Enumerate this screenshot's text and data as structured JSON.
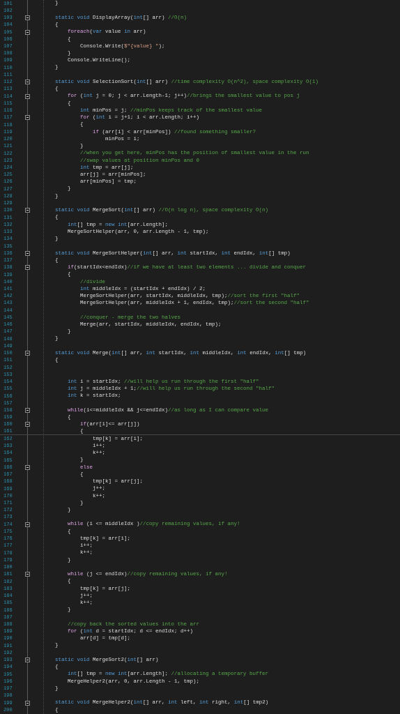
{
  "editor": {
    "lines": [
      {
        "number": "101",
        "foldable": false,
        "current": false,
        "tokens": [
          {
            "kind": "plain",
            "text": "        }"
          }
        ]
      },
      {
        "number": "102",
        "foldable": false,
        "current": false
      },
      {
        "number": "103",
        "foldable": true,
        "current": false,
        "tokens": [
          {
            "kind": "keyword",
            "text": "        static void "
          },
          {
            "kind": "plain",
            "text": "DisplayArray("
          },
          {
            "kind": "keyword",
            "text": "int"
          },
          {
            "kind": "plain",
            "text": "[] arr) "
          },
          {
            "kind": "comment",
            "text": "//O(n)"
          }
        ]
      },
      {
        "number": "104",
        "foldable": false,
        "current": false,
        "tokens": [
          {
            "kind": "plain",
            "text": "        {"
          }
        ]
      },
      {
        "number": "105",
        "foldable": true,
        "current": false,
        "tokens": [
          {
            "kind": "control",
            "text": "            foreach"
          },
          {
            "kind": "plain",
            "text": "("
          },
          {
            "kind": "keyword",
            "text": "var"
          },
          {
            "kind": "plain",
            "text": " value "
          },
          {
            "kind": "keyword",
            "text": "in"
          },
          {
            "kind": "plain",
            "text": " arr)"
          }
        ]
      },
      {
        "number": "106",
        "foldable": false,
        "current": false,
        "tokens": [
          {
            "kind": "plain",
            "text": "            {"
          }
        ]
      },
      {
        "number": "107",
        "foldable": false,
        "current": false,
        "tokens": [
          {
            "kind": "plain",
            "text": "                Console.Write("
          },
          {
            "kind": "string",
            "text": "$\"{value} \""
          },
          {
            "kind": "plain",
            "text": ");"
          }
        ]
      },
      {
        "number": "108",
        "foldable": false,
        "current": false,
        "tokens": [
          {
            "kind": "plain",
            "text": "            }"
          }
        ]
      },
      {
        "number": "109",
        "foldable": false,
        "current": false,
        "tokens": [
          {
            "kind": "plain",
            "text": "            Console.WriteLine();"
          }
        ]
      },
      {
        "number": "110",
        "foldable": false,
        "current": false,
        "tokens": [
          {
            "kind": "plain",
            "text": "        }"
          }
        ]
      },
      {
        "number": "111",
        "foldable": false,
        "current": false
      },
      {
        "number": "112",
        "foldable": true,
        "current": false,
        "tokens": [
          {
            "kind": "keyword",
            "text": "        static void "
          },
          {
            "kind": "plain",
            "text": "SelectionSort("
          },
          {
            "kind": "keyword",
            "text": "int"
          },
          {
            "kind": "plain",
            "text": "[] arr) "
          },
          {
            "kind": "comment",
            "text": "//time complexity O(n^2), space complexity O(1)"
          }
        ]
      },
      {
        "number": "113",
        "foldable": false,
        "current": false,
        "tokens": [
          {
            "kind": "plain",
            "text": "        {"
          }
        ]
      },
      {
        "number": "114",
        "foldable": true,
        "current": false,
        "tokens": [
          {
            "kind": "control",
            "text": "            for"
          },
          {
            "kind": "plain",
            "text": " ("
          },
          {
            "kind": "keyword",
            "text": "int"
          },
          {
            "kind": "plain",
            "text": " j = 0; j < arr.Length-1; j++)"
          },
          {
            "kind": "comment",
            "text": "//brings the smallest value to pos j"
          }
        ]
      },
      {
        "number": "115",
        "foldable": false,
        "current": false,
        "tokens": [
          {
            "kind": "plain",
            "text": "            {"
          }
        ]
      },
      {
        "number": "116",
        "foldable": false,
        "current": false,
        "tokens": [
          {
            "kind": "keyword",
            "text": "                int"
          },
          {
            "kind": "plain",
            "text": " minPos = j; "
          },
          {
            "kind": "comment",
            "text": "//minPos keeps track of the smallest value"
          }
        ]
      },
      {
        "number": "117",
        "foldable": true,
        "current": false,
        "tokens": [
          {
            "kind": "control",
            "text": "                for"
          },
          {
            "kind": "plain",
            "text": " ("
          },
          {
            "kind": "keyword",
            "text": "int"
          },
          {
            "kind": "plain",
            "text": " i = j+1; i < arr.Length; i++)"
          }
        ]
      },
      {
        "number": "118",
        "foldable": false,
        "current": false,
        "tokens": [
          {
            "kind": "plain",
            "text": "                {"
          }
        ]
      },
      {
        "number": "119",
        "foldable": false,
        "current": false,
        "tokens": [
          {
            "kind": "control",
            "text": "                    if"
          },
          {
            "kind": "plain",
            "text": " (arr[i] < arr[minPos]) "
          },
          {
            "kind": "comment",
            "text": "//found something smaller?"
          }
        ]
      },
      {
        "number": "120",
        "foldable": false,
        "current": false,
        "tokens": [
          {
            "kind": "plain",
            "text": "                        minPos = i;"
          }
        ]
      },
      {
        "number": "121",
        "foldable": false,
        "current": false,
        "tokens": [
          {
            "kind": "plain",
            "text": "                }"
          }
        ]
      },
      {
        "number": "122",
        "foldable": false,
        "current": false,
        "tokens": [
          {
            "kind": "comment",
            "text": "                //when you get here, minPos has the position of smallest value in the run"
          }
        ]
      },
      {
        "number": "123",
        "foldable": false,
        "current": false,
        "tokens": [
          {
            "kind": "comment",
            "text": "                //swap values at position minPos and 0"
          }
        ]
      },
      {
        "number": "124",
        "foldable": false,
        "current": false,
        "tokens": [
          {
            "kind": "keyword",
            "text": "                int"
          },
          {
            "kind": "plain",
            "text": " tmp = arr[j];"
          }
        ]
      },
      {
        "number": "125",
        "foldable": false,
        "current": false,
        "tokens": [
          {
            "kind": "plain",
            "text": "                arr[j] = arr[minPos];"
          }
        ]
      },
      {
        "number": "126",
        "foldable": false,
        "current": false,
        "tokens": [
          {
            "kind": "plain",
            "text": "                arr[minPos] = tmp;"
          }
        ]
      },
      {
        "number": "127",
        "foldable": false,
        "current": false,
        "tokens": [
          {
            "kind": "plain",
            "text": "            }"
          }
        ]
      },
      {
        "number": "128",
        "foldable": false,
        "current": false,
        "tokens": [
          {
            "kind": "plain",
            "text": "        }"
          }
        ]
      },
      {
        "number": "129",
        "foldable": false,
        "current": false
      },
      {
        "number": "130",
        "foldable": true,
        "current": false,
        "tokens": [
          {
            "kind": "keyword",
            "text": "        static void "
          },
          {
            "kind": "plain",
            "text": "MergeSort("
          },
          {
            "kind": "keyword",
            "text": "int"
          },
          {
            "kind": "plain",
            "text": "[] arr) "
          },
          {
            "kind": "comment",
            "text": "//O(n log n), space complexity O(n)"
          }
        ]
      },
      {
        "number": "131",
        "foldable": false,
        "current": false,
        "tokens": [
          {
            "kind": "plain",
            "text": "        {"
          }
        ]
      },
      {
        "number": "132",
        "foldable": false,
        "current": false,
        "tokens": [
          {
            "kind": "keyword",
            "text": "            int"
          },
          {
            "kind": "plain",
            "text": "[] tmp = "
          },
          {
            "kind": "keyword",
            "text": "new int"
          },
          {
            "kind": "plain",
            "text": "[arr.Length];"
          }
        ]
      },
      {
        "number": "133",
        "foldable": false,
        "current": false,
        "tokens": [
          {
            "kind": "plain",
            "text": "            MergeSortHelper(arr, 0, arr.Length - 1, tmp);"
          }
        ]
      },
      {
        "number": "134",
        "foldable": false,
        "current": false,
        "tokens": [
          {
            "kind": "plain",
            "text": "        }"
          }
        ]
      },
      {
        "number": "135",
        "foldable": false,
        "current": false
      },
      {
        "number": "136",
        "foldable": true,
        "current": false,
        "tokens": [
          {
            "kind": "keyword",
            "text": "        static void "
          },
          {
            "kind": "plain",
            "text": "MergeSortHelper("
          },
          {
            "kind": "keyword",
            "text": "int"
          },
          {
            "kind": "plain",
            "text": "[] arr, "
          },
          {
            "kind": "keyword",
            "text": "int"
          },
          {
            "kind": "plain",
            "text": " startIdx, "
          },
          {
            "kind": "keyword",
            "text": "int"
          },
          {
            "kind": "plain",
            "text": " endIdx, "
          },
          {
            "kind": "keyword",
            "text": "int"
          },
          {
            "kind": "plain",
            "text": "[] tmp)"
          }
        ]
      },
      {
        "number": "137",
        "foldable": false,
        "current": false,
        "tokens": [
          {
            "kind": "plain",
            "text": "        {"
          }
        ]
      },
      {
        "number": "138",
        "foldable": true,
        "current": false,
        "tokens": [
          {
            "kind": "control",
            "text": "            if"
          },
          {
            "kind": "plain",
            "text": "(startIdx<endIdx)"
          },
          {
            "kind": "comment",
            "text": "//if we have at least two elements ... divide and conquer"
          }
        ]
      },
      {
        "number": "139",
        "foldable": false,
        "current": false,
        "tokens": [
          {
            "kind": "plain",
            "text": "            {"
          }
        ]
      },
      {
        "number": "140",
        "foldable": false,
        "current": false,
        "tokens": [
          {
            "kind": "comment",
            "text": "                //divide"
          }
        ]
      },
      {
        "number": "141",
        "foldable": false,
        "current": false,
        "tokens": [
          {
            "kind": "keyword",
            "text": "                int"
          },
          {
            "kind": "plain",
            "text": " middleIdx = (startIdx + endIdx) / 2;"
          }
        ]
      },
      {
        "number": "142",
        "foldable": false,
        "current": false,
        "tokens": [
          {
            "kind": "plain",
            "text": "                MergeSortHelper(arr, startIdx, middleIdx, tmp);"
          },
          {
            "kind": "comment",
            "text": "//sort the first \"half\""
          }
        ]
      },
      {
        "number": "143",
        "foldable": false,
        "current": false,
        "tokens": [
          {
            "kind": "plain",
            "text": "                MergeSortHelper(arr, middleIdx + 1, endIdx, tmp);"
          },
          {
            "kind": "comment",
            "text": "//sort the second \"half\""
          }
        ]
      },
      {
        "number": "144",
        "foldable": false,
        "current": false
      },
      {
        "number": "145",
        "foldable": false,
        "current": false,
        "tokens": [
          {
            "kind": "comment",
            "text": "                //conquer - merge the two halves"
          }
        ]
      },
      {
        "number": "146",
        "foldable": false,
        "current": false,
        "tokens": [
          {
            "kind": "plain",
            "text": "                Merge(arr, startIdx, middleIdx, endIdx, tmp);"
          }
        ]
      },
      {
        "number": "147",
        "foldable": false,
        "current": false,
        "tokens": [
          {
            "kind": "plain",
            "text": "            }"
          }
        ]
      },
      {
        "number": "148",
        "foldable": false,
        "current": false,
        "tokens": [
          {
            "kind": "plain",
            "text": "        }"
          }
        ]
      },
      {
        "number": "149",
        "foldable": false,
        "current": false
      },
      {
        "number": "150",
        "foldable": true,
        "current": false,
        "tokens": [
          {
            "kind": "keyword",
            "text": "        static void "
          },
          {
            "kind": "plain",
            "text": "Merge("
          },
          {
            "kind": "keyword",
            "text": "int"
          },
          {
            "kind": "plain",
            "text": "[] arr, "
          },
          {
            "kind": "keyword",
            "text": "int"
          },
          {
            "kind": "plain",
            "text": " startIdx, "
          },
          {
            "kind": "keyword",
            "text": "int"
          },
          {
            "kind": "plain",
            "text": " middleIdx, "
          },
          {
            "kind": "keyword",
            "text": "int"
          },
          {
            "kind": "plain",
            "text": " endIdx, "
          },
          {
            "kind": "keyword",
            "text": "int"
          },
          {
            "kind": "plain",
            "text": "[] tmp)"
          }
        ]
      },
      {
        "number": "151",
        "foldable": false,
        "current": false,
        "tokens": [
          {
            "kind": "plain",
            "text": "        {"
          }
        ]
      },
      {
        "number": "152",
        "foldable": false,
        "current": false
      },
      {
        "number": "153",
        "foldable": false,
        "current": false
      },
      {
        "number": "154",
        "foldable": false,
        "current": false,
        "tokens": [
          {
            "kind": "keyword",
            "text": "            int"
          },
          {
            "kind": "plain",
            "text": " i = startIdx; "
          },
          {
            "kind": "comment",
            "text": "//will help us run through the first \"half\""
          }
        ]
      },
      {
        "number": "155",
        "foldable": false,
        "current": false,
        "tokens": [
          {
            "kind": "keyword",
            "text": "            int"
          },
          {
            "kind": "plain",
            "text": " j = middleIdx + 1;"
          },
          {
            "kind": "comment",
            "text": "//will help us run through the second \"half\""
          }
        ]
      },
      {
        "number": "156",
        "foldable": false,
        "current": false,
        "tokens": [
          {
            "kind": "keyword",
            "text": "            int"
          },
          {
            "kind": "plain",
            "text": " k = startIdx;"
          }
        ]
      },
      {
        "number": "157",
        "foldable": false,
        "current": false
      },
      {
        "number": "158",
        "foldable": true,
        "current": false,
        "tokens": [
          {
            "kind": "control",
            "text": "            while"
          },
          {
            "kind": "plain",
            "text": "(i<=middleIdx && j<=endIdx)"
          },
          {
            "kind": "comment",
            "text": "//as long as I can compare value"
          }
        ]
      },
      {
        "number": "159",
        "foldable": false,
        "current": false,
        "tokens": [
          {
            "kind": "plain",
            "text": "            {"
          }
        ]
      },
      {
        "number": "160",
        "foldable": true,
        "current": false,
        "tokens": [
          {
            "kind": "control",
            "text": "                if"
          },
          {
            "kind": "plain",
            "text": "(arr[i]<= arr[j])"
          }
        ]
      },
      {
        "number": "161",
        "foldable": false,
        "current": true,
        "tokens": [
          {
            "kind": "plain",
            "text": "                {"
          }
        ]
      },
      {
        "number": "162",
        "foldable": false,
        "current": false,
        "tokens": [
          {
            "kind": "plain",
            "text": "                    tmp[k] = arr[i];"
          }
        ]
      },
      {
        "number": "163",
        "foldable": false,
        "current": false,
        "tokens": [
          {
            "kind": "plain",
            "text": "                    i++;"
          }
        ]
      },
      {
        "number": "164",
        "foldable": false,
        "current": false,
        "tokens": [
          {
            "kind": "plain",
            "text": "                    k++;"
          }
        ]
      },
      {
        "number": "165",
        "foldable": false,
        "current": false,
        "tokens": [
          {
            "kind": "plain",
            "text": "                }"
          }
        ]
      },
      {
        "number": "166",
        "foldable": true,
        "current": false,
        "tokens": [
          {
            "kind": "control",
            "text": "                else"
          }
        ]
      },
      {
        "number": "167",
        "foldable": false,
        "current": false,
        "tokens": [
          {
            "kind": "plain",
            "text": "                {"
          }
        ]
      },
      {
        "number": "168",
        "foldable": false,
        "current": false,
        "tokens": [
          {
            "kind": "plain",
            "text": "                    tmp[k] = arr[j];"
          }
        ]
      },
      {
        "number": "169",
        "foldable": false,
        "current": false,
        "tokens": [
          {
            "kind": "plain",
            "text": "                    j++;"
          }
        ]
      },
      {
        "number": "170",
        "foldable": false,
        "current": false,
        "tokens": [
          {
            "kind": "plain",
            "text": "                    k++;"
          }
        ]
      },
      {
        "number": "171",
        "foldable": false,
        "current": false,
        "tokens": [
          {
            "kind": "plain",
            "text": "                }"
          }
        ]
      },
      {
        "number": "172",
        "foldable": false,
        "current": false,
        "tokens": [
          {
            "kind": "plain",
            "text": "            }"
          }
        ]
      },
      {
        "number": "173",
        "foldable": false,
        "current": false
      },
      {
        "number": "174",
        "foldable": true,
        "current": false,
        "tokens": [
          {
            "kind": "control",
            "text": "            while"
          },
          {
            "kind": "plain",
            "text": " (i <= middleIdx )"
          },
          {
            "kind": "comment",
            "text": "//copy remaining values, if any!"
          }
        ]
      },
      {
        "number": "175",
        "foldable": false,
        "current": false,
        "tokens": [
          {
            "kind": "plain",
            "text": "            {"
          }
        ]
      },
      {
        "number": "176",
        "foldable": false,
        "current": false,
        "tokens": [
          {
            "kind": "plain",
            "text": "                tmp[k] = arr[i];"
          }
        ]
      },
      {
        "number": "177",
        "foldable": false,
        "current": false,
        "tokens": [
          {
            "kind": "plain",
            "text": "                i++;"
          }
        ]
      },
      {
        "number": "178",
        "foldable": false,
        "current": false,
        "tokens": [
          {
            "kind": "plain",
            "text": "                k++;"
          }
        ]
      },
      {
        "number": "179",
        "foldable": false,
        "current": false,
        "tokens": [
          {
            "kind": "plain",
            "text": "            }"
          }
        ]
      },
      {
        "number": "180",
        "foldable": false,
        "current": false
      },
      {
        "number": "181",
        "foldable": true,
        "current": false,
        "tokens": [
          {
            "kind": "control",
            "text": "            while"
          },
          {
            "kind": "plain",
            "text": " (j <= endIdx)"
          },
          {
            "kind": "comment",
            "text": "//copy remaining values, if any!"
          }
        ]
      },
      {
        "number": "182",
        "foldable": false,
        "current": false,
        "tokens": [
          {
            "kind": "plain",
            "text": "            {"
          }
        ]
      },
      {
        "number": "183",
        "foldable": false,
        "current": false,
        "tokens": [
          {
            "kind": "plain",
            "text": "                tmp[k] = arr[j];"
          }
        ]
      },
      {
        "number": "184",
        "foldable": false,
        "current": false,
        "tokens": [
          {
            "kind": "plain",
            "text": "                j++;"
          }
        ]
      },
      {
        "number": "185",
        "foldable": false,
        "current": false,
        "tokens": [
          {
            "kind": "plain",
            "text": "                k++;"
          }
        ]
      },
      {
        "number": "186",
        "foldable": false,
        "current": false,
        "tokens": [
          {
            "kind": "plain",
            "text": "            }"
          }
        ]
      },
      {
        "number": "187",
        "foldable": false,
        "current": false
      },
      {
        "number": "188",
        "foldable": false,
        "current": false,
        "tokens": [
          {
            "kind": "comment",
            "text": "            //copy back the sorted values into the arr"
          }
        ]
      },
      {
        "number": "189",
        "foldable": false,
        "current": false,
        "tokens": [
          {
            "kind": "control",
            "text": "            for"
          },
          {
            "kind": "plain",
            "text": " ("
          },
          {
            "kind": "keyword",
            "text": "int"
          },
          {
            "kind": "plain",
            "text": " d = startIdx; d <= endIdx; d++)"
          }
        ]
      },
      {
        "number": "190",
        "foldable": false,
        "current": false,
        "tokens": [
          {
            "kind": "plain",
            "text": "                arr[d] = tmp[d];"
          }
        ]
      },
      {
        "number": "191",
        "foldable": false,
        "current": false,
        "tokens": [
          {
            "kind": "plain",
            "text": "        }"
          }
        ]
      },
      {
        "number": "192",
        "foldable": false,
        "current": false
      },
      {
        "number": "193",
        "foldable": true,
        "current": false,
        "tokens": [
          {
            "kind": "keyword",
            "text": "        static void "
          },
          {
            "kind": "plain",
            "text": "MergeSort2("
          },
          {
            "kind": "keyword",
            "text": "int"
          },
          {
            "kind": "plain",
            "text": "[] arr)"
          }
        ]
      },
      {
        "number": "194",
        "foldable": false,
        "current": false,
        "tokens": [
          {
            "kind": "plain",
            "text": "        {"
          }
        ]
      },
      {
        "number": "195",
        "foldable": false,
        "current": false,
        "tokens": [
          {
            "kind": "keyword",
            "text": "            int"
          },
          {
            "kind": "plain",
            "text": "[] tmp = "
          },
          {
            "kind": "keyword",
            "text": "new int"
          },
          {
            "kind": "plain",
            "text": "[arr.Length]; "
          },
          {
            "kind": "comment",
            "text": "//allocating a temporary buffer"
          }
        ]
      },
      {
        "number": "196",
        "foldable": false,
        "current": false,
        "tokens": [
          {
            "kind": "plain",
            "text": "            MergeHelper2(arr, 0, arr.Length - 1, tmp);"
          }
        ]
      },
      {
        "number": "197",
        "foldable": false,
        "current": false,
        "tokens": [
          {
            "kind": "plain",
            "text": "        }"
          }
        ]
      },
      {
        "number": "198",
        "foldable": false,
        "current": false
      },
      {
        "number": "199",
        "foldable": true,
        "current": false,
        "tokens": [
          {
            "kind": "keyword",
            "text": "        static void "
          },
          {
            "kind": "plain",
            "text": "MergeHelper2("
          },
          {
            "kind": "keyword",
            "text": "int"
          },
          {
            "kind": "plain",
            "text": "[] arr, "
          },
          {
            "kind": "keyword",
            "text": "int"
          },
          {
            "kind": "plain",
            "text": " left, "
          },
          {
            "kind": "keyword",
            "text": "int"
          },
          {
            "kind": "plain",
            "text": " right, "
          },
          {
            "kind": "keyword",
            "text": "int"
          },
          {
            "kind": "plain",
            "text": "[] tmp2)"
          }
        ]
      },
      {
        "number": "200",
        "foldable": false,
        "current": false,
        "tokens": [
          {
            "kind": "plain",
            "text": "        {"
          }
        ]
      }
    ]
  }
}
